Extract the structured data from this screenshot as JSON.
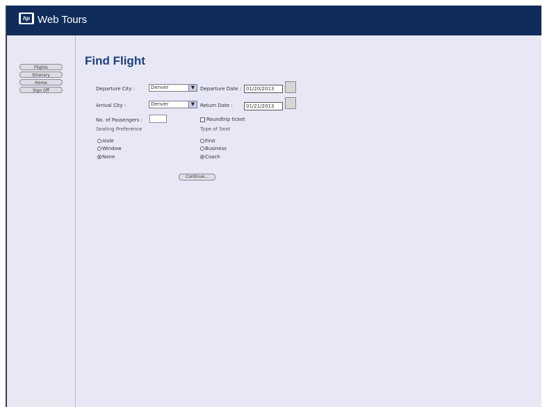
{
  "header": {
    "app_title": "Web Tours",
    "logo_text": "hp",
    "logo_icon": "hp-logo-icon"
  },
  "sidebar": {
    "items": [
      {
        "label": "Flights"
      },
      {
        "label": "Itinerary"
      },
      {
        "label": "Home"
      },
      {
        "label": "Sign Off"
      }
    ]
  },
  "form": {
    "title": "Find Flight",
    "depart_city": {
      "label": "Departure City :",
      "value": "Denver"
    },
    "depart_date": {
      "label": "Departure Date :",
      "value": "01/20/2013"
    },
    "arrive_city": {
      "label": "Arrival City :",
      "value": "Denver"
    },
    "return_date": {
      "label": "Return Date :",
      "value": "01/21/2013"
    },
    "passengers": {
      "label": "No. of Passengers :",
      "value": ""
    },
    "roundtrip": {
      "label": "Roundtrip ticket",
      "checked": false
    },
    "seating": {
      "label": "Seating Preference",
      "options": [
        "Aisle",
        "Window",
        "None"
      ],
      "selected": "None"
    },
    "seat_type": {
      "label": "Type of Seat",
      "options": [
        "First",
        "Business",
        "Coach"
      ],
      "selected": "Coach"
    },
    "continue_label": "Continue..."
  }
}
